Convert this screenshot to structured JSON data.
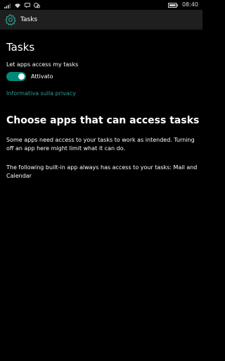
{
  "status_bar": {
    "time": "08:40",
    "icons": [
      "signal-icon",
      "wifi-icon",
      "notification-icon",
      "battery-icon"
    ]
  },
  "header": {
    "icon": "gear-icon",
    "title": "Tasks"
  },
  "section": {
    "title": "Tasks",
    "toggle_label": "Let apps access my tasks",
    "toggle_state_text": "Attivato",
    "toggle_on": true,
    "privacy_link": "Informativa sulla privacy"
  },
  "apps": {
    "title": "Choose apps that can access tasks",
    "description": "Some apps need access to your tasks to work as intended. Turning off an app here might limit what it can do.",
    "builtin_note": "The following built-in app always has access to your tasks: Mail and Calendar"
  },
  "colors": {
    "accent": "#00897b",
    "link": "#2e9e93",
    "header_bg": "#1f1f1f",
    "background": "#000000"
  }
}
